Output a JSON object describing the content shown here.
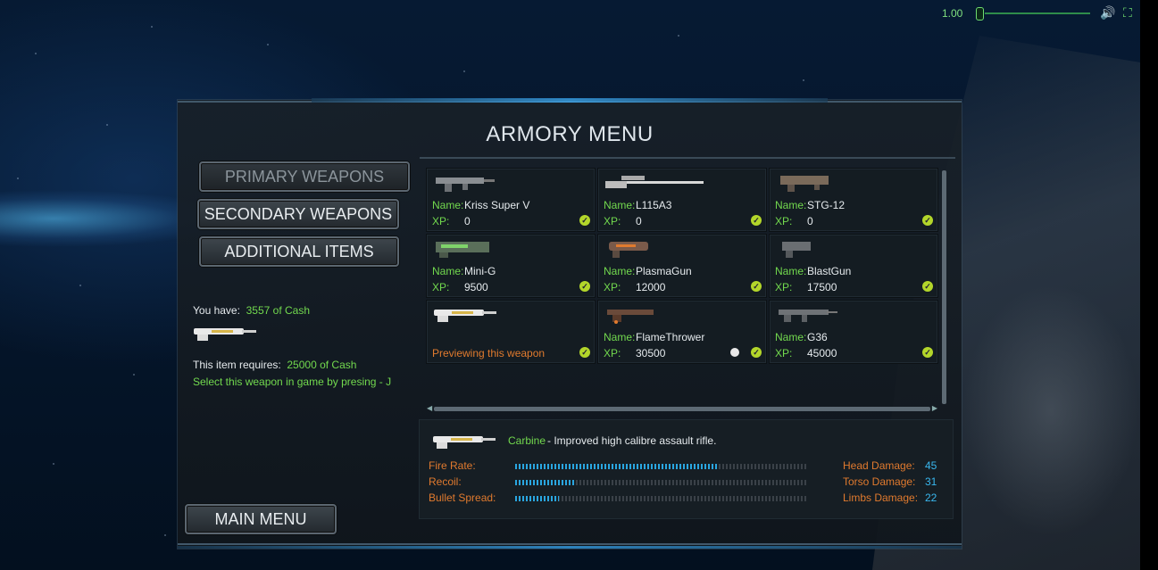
{
  "top_bar": {
    "version": "1.00",
    "volume_icon": "speaker-icon",
    "fullscreen_icon": "fullscreen-icon",
    "volume_level": 0.0
  },
  "title": "ARMORY MENU",
  "menu": {
    "primary": "PRIMARY WEAPONS",
    "secondary": "SECONDARY WEAPONS",
    "additional": "ADDITIONAL ITEMS",
    "main": "MAIN MENU"
  },
  "info": {
    "you_have_label": "You have:",
    "cash": "3557 of Cash",
    "requires_label": "This item requires:",
    "requires_value": "25000 of Cash",
    "hint": "Select this weapon in game by presing - J"
  },
  "labels": {
    "name": "Name:",
    "xp": "XP:"
  },
  "weapons": [
    {
      "name": "Kriss Super V",
      "xp": "0"
    },
    {
      "name": "L115A3",
      "xp": "0"
    },
    {
      "name": "STG-12",
      "xp": "0"
    },
    {
      "name": "Mini-G",
      "xp": "9500"
    },
    {
      "name": "PlasmaGun",
      "xp": "12000"
    },
    {
      "name": "BlastGun",
      "xp": "17500"
    },
    {
      "preview": "Previewing this weapon"
    },
    {
      "name": "FlameThrower",
      "xp": "30500"
    },
    {
      "name": "G36",
      "xp": "45000"
    }
  ],
  "details": {
    "name": "Carbine",
    "description": "-  Improved high calibre assault rifle.",
    "stats": [
      {
        "label": "Fire Rate:",
        "fill": 0.7
      },
      {
        "label": "Recoil:",
        "fill": 0.21
      },
      {
        "label": "Bullet Spread:",
        "fill": 0.15
      }
    ],
    "damage": [
      {
        "label": "Head Damage:",
        "value": "45"
      },
      {
        "label": "Torso Damage:",
        "value": "31"
      },
      {
        "label": "Limbs Damage:",
        "value": "22"
      }
    ]
  },
  "colors": {
    "accent_green": "#72d94e",
    "accent_orange": "#e07a2e",
    "accent_blue": "#39b7ee"
  }
}
